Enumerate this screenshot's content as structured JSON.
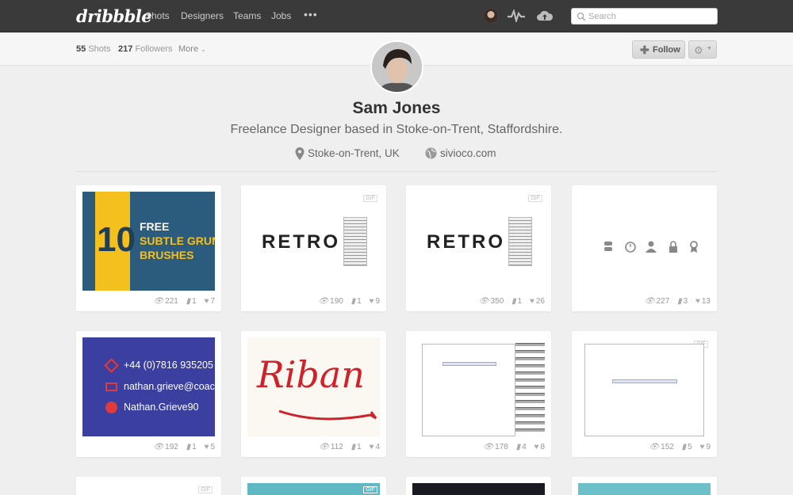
{
  "nav": {
    "logo": "dribbble",
    "links": [
      "Shots",
      "Designers",
      "Teams",
      "Jobs"
    ],
    "more": "•••",
    "search_placeholder": "Search"
  },
  "subbar": {
    "shots_count": "55",
    "shots_label": "Shots",
    "followers_count": "217",
    "followers_label": "Followers",
    "more_label": "More",
    "follow_label": "Follow"
  },
  "profile": {
    "name": "Sam Jones",
    "bio": "Freelance Designer based in Stoke-on-Trent, Staffordshire.",
    "location": "Stoke-on-Trent, UK",
    "website": "sivioco.com"
  },
  "shots": [
    {
      "views": "221",
      "comments": "1",
      "likes": "7",
      "gif": false,
      "thumb": {
        "num": "10",
        "l1": "FREE",
        "l2": "SUBTLE GRUNGE",
        "l3": "BRUSHES"
      }
    },
    {
      "views": "190",
      "comments": "1",
      "likes": "9",
      "gif": true,
      "thumb": {
        "word": "RETRO"
      }
    },
    {
      "views": "350",
      "comments": "1",
      "likes": "26",
      "gif": true,
      "thumb": {
        "word": "RETRO"
      }
    },
    {
      "views": "227",
      "comments": "3",
      "likes": "13",
      "gif": false,
      "thumb": {}
    },
    {
      "views": "192",
      "comments": "1",
      "likes": "5",
      "gif": false,
      "thumb": {
        "phone": "+44 (0)7816 935205",
        "email": "nathan.grieve@coac",
        "skype": "Nathan.Grieve90"
      }
    },
    {
      "views": "112",
      "comments": "1",
      "likes": "4",
      "gif": false,
      "thumb": {
        "word": "Riban"
      }
    },
    {
      "views": "178",
      "comments": "4",
      "likes": "8",
      "gif": true,
      "thumb": {}
    },
    {
      "views": "152",
      "comments": "5",
      "likes": "9",
      "gif": true,
      "thumb": {}
    }
  ],
  "gif_label": "GIF",
  "colors": {
    "topbar": "#3a3a3a",
    "thumb1_bg": "#2b5b7d",
    "thumb1_accent": "#f4c01e",
    "thumb5_bg": "#3a3fa0",
    "riban_red": "#d0202a"
  }
}
